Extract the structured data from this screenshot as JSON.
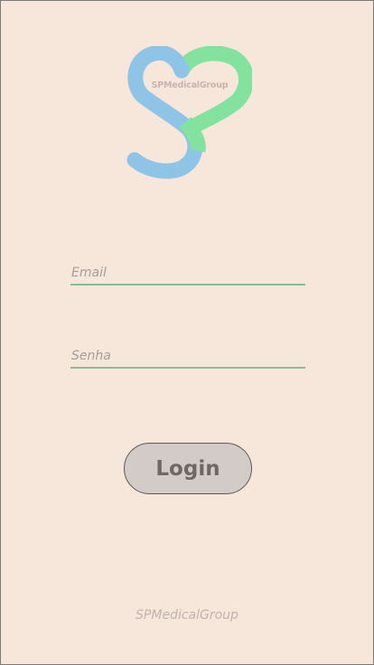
{
  "logo": {
    "icon": "heart-s-logo-icon",
    "text": "SPMedicalGroup",
    "colors": {
      "blue": "#8ec4e6",
      "green": "#82e29e"
    }
  },
  "form": {
    "email_placeholder": "Email",
    "senha_placeholder": "Senha",
    "login_label": "Login"
  },
  "footer": {
    "text": "SPMedicalGroup"
  },
  "colors": {
    "background": "#f7e6da",
    "underline": "#86bd97",
    "button_bg": "#d3cbc8"
  }
}
